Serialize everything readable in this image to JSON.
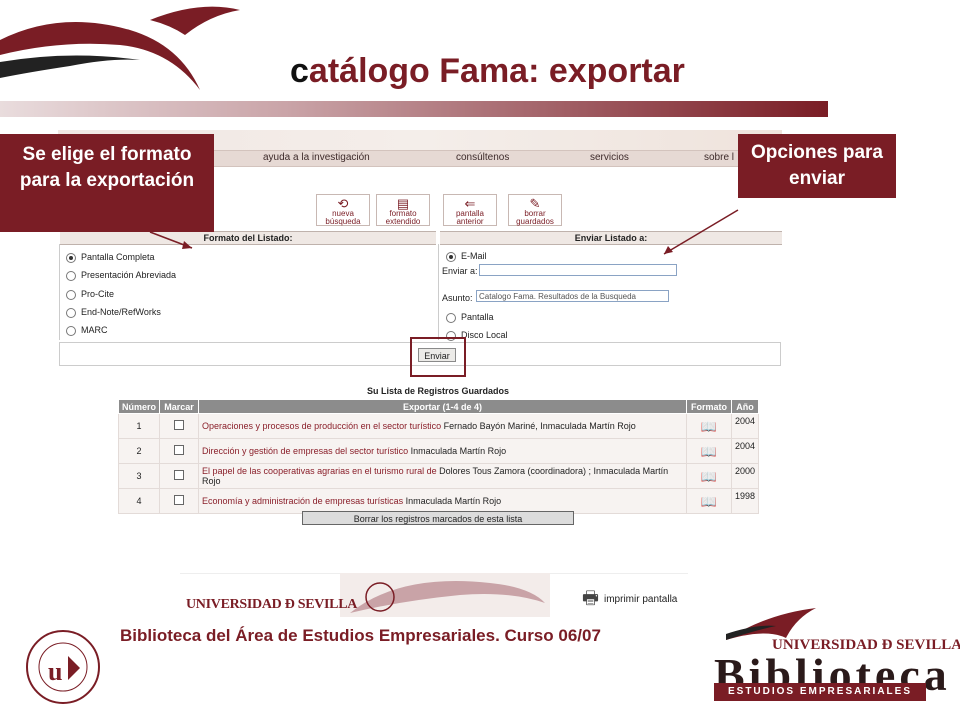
{
  "slide": {
    "title_first": "c",
    "title_rest": "atálogo Fama: exportar",
    "callout_left": "Se elige el formato para la exportación",
    "callout_right": "Opciones para enviar",
    "footer_caption": "Biblioteca del Área de Estudios Empresariales. Curso 06/07"
  },
  "nav": [
    "ayuda a la investigación",
    "consúltenos",
    "servicios",
    "sobre l"
  ],
  "toolbar": [
    {
      "label": "nueva búsqueda",
      "icon": "refresh-icon"
    },
    {
      "label": "formato extendido",
      "icon": "document-icon"
    },
    {
      "label": "pantalla anterior",
      "icon": "back-icon"
    },
    {
      "label": "borrar guardados",
      "icon": "delete-icon"
    }
  ],
  "format_panel": {
    "title": "Formato del Listado:",
    "options": [
      "Pantalla Completa",
      "Presentación Abreviada",
      "Pro-Cite",
      "End-Note/RefWorks",
      "MARC"
    ],
    "selected": 0
  },
  "send_panel": {
    "title": "Enviar Listado a:",
    "email_label": "E-Mail",
    "to_label": "Enviar a:",
    "to_value": "",
    "subject_label": "Asunto:",
    "subject_value": "Catalogo Fama. Resultados de la Busqueda",
    "screen_label": "Pantalla",
    "disk_label": "Disco Local"
  },
  "send_button": "Enviar",
  "records": {
    "title": "Su Lista de Registros Guardados",
    "headers": [
      "Número",
      "Marcar",
      "Exportar (1-4 de 4)",
      "Formato",
      "Año"
    ],
    "rows": [
      {
        "num": "1",
        "title": "Operaciones y procesos de producción en el sector turístico",
        "author": "Fernado Bayón Mariné, Inmaculada Martín Rojo",
        "year": "2004"
      },
      {
        "num": "2",
        "title": "Dirección y gestión de empresas del sector turístico",
        "author": "Inmaculada Martín Rojo",
        "year": "2004"
      },
      {
        "num": "3",
        "title": "El papel de las cooperativas agrarias en el turismo rural de",
        "author": "Dolores Tous Zamora (coordinadora) ; Inmaculada Martín Rojo",
        "year": "2000"
      },
      {
        "num": "4",
        "title": "Economía y administración de empresas turísticas",
        "author": "Inmaculada Martín Rojo",
        "year": "1998"
      }
    ],
    "delete_button": "Borrar los registros marcados de esta lista"
  },
  "footer_band": {
    "univ": "UNIVERSIDAD Ð SEVILLA",
    "print_label": "imprimir pantalla"
  },
  "logo": {
    "univ": "UNIVERSIDAD Ð SEVILLA",
    "name": "Biblioteca",
    "sub": "ESTUDIOS EMPRESARIALES",
    "seal_text": "UNIVERSIDAD DE SEVILLA"
  },
  "colors": {
    "brand": "#7a1d25"
  }
}
